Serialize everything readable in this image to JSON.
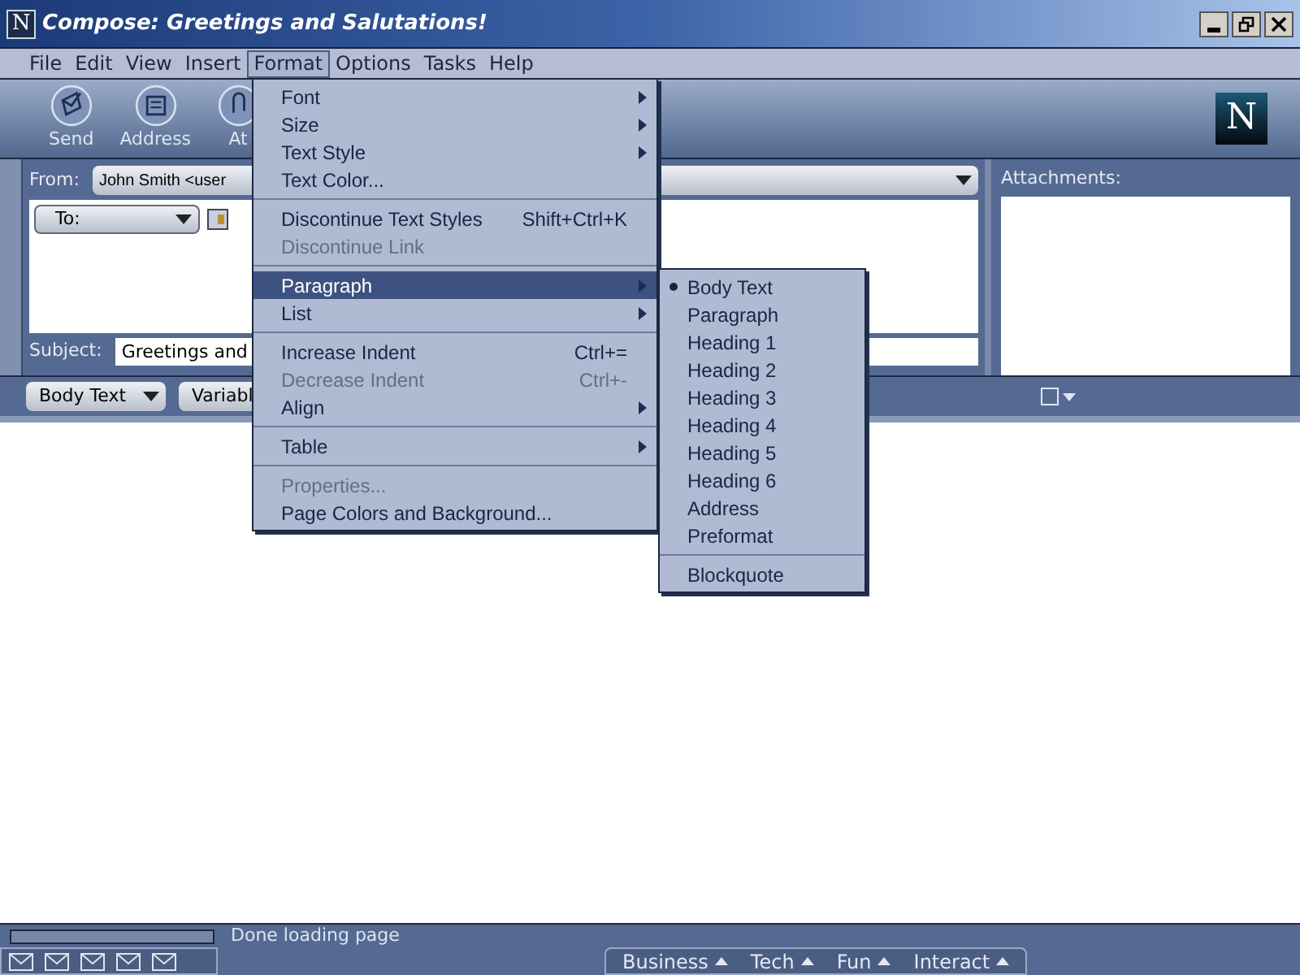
{
  "window": {
    "title": "Compose: Greetings and Salutations!",
    "logo_letter": "N"
  },
  "brand_letter": "N",
  "menubar": [
    {
      "label": "File",
      "selected": false
    },
    {
      "label": "Edit",
      "selected": false
    },
    {
      "label": "View",
      "selected": false
    },
    {
      "label": "Insert",
      "selected": false
    },
    {
      "label": "Format",
      "selected": true
    },
    {
      "label": "Options",
      "selected": false
    },
    {
      "label": "Tasks",
      "selected": false
    },
    {
      "label": "Help",
      "selected": false
    }
  ],
  "toolbar": [
    {
      "label": "Send",
      "kind": "send"
    },
    {
      "label": "Address",
      "kind": "address"
    },
    {
      "label": "At",
      "kind": "attach"
    }
  ],
  "header": {
    "from_label": "From:",
    "from_value": "John Smith <user",
    "to_label": "To:",
    "subject_label": "Subject:",
    "subject_value": "Greetings and",
    "attachments_label": "Attachments:"
  },
  "format_toolbar": {
    "style": "Body Text",
    "font": "Variabl"
  },
  "format_menu": [
    [
      {
        "label": "Font",
        "submenu": true,
        "disabled": false,
        "selected": false
      },
      {
        "label": "Size",
        "submenu": true,
        "disabled": false,
        "selected": false
      },
      {
        "label": "Text Style",
        "submenu": true,
        "disabled": false,
        "selected": false
      },
      {
        "label": "Text Color...",
        "submenu": false,
        "disabled": false,
        "selected": false
      }
    ],
    [
      {
        "label": "Discontinue Text Styles",
        "shortcut": "Shift+Ctrl+K",
        "submenu": false,
        "disabled": false,
        "selected": false
      },
      {
        "label": "Discontinue Link",
        "submenu": false,
        "disabled": true,
        "selected": false
      }
    ],
    [
      {
        "label": "Paragraph",
        "submenu": true,
        "disabled": false,
        "selected": true
      },
      {
        "label": "List",
        "submenu": true,
        "disabled": false,
        "selected": false
      }
    ],
    [
      {
        "label": "Increase Indent",
        "shortcut": "Ctrl+=",
        "submenu": false,
        "disabled": false,
        "selected": false
      },
      {
        "label": "Decrease Indent",
        "shortcut": "Ctrl+-",
        "submenu": false,
        "disabled": true,
        "selected": false
      },
      {
        "label": "Align",
        "submenu": true,
        "disabled": false,
        "selected": false
      }
    ],
    [
      {
        "label": "Table",
        "submenu": true,
        "disabled": false,
        "selected": false
      }
    ],
    [
      {
        "label": "Properties...",
        "submenu": false,
        "disabled": true,
        "selected": false
      },
      {
        "label": "Page Colors and Background...",
        "submenu": false,
        "disabled": false,
        "selected": false
      }
    ]
  ],
  "paragraph_menu": [
    [
      {
        "label": "Body Text",
        "checked": true
      },
      {
        "label": "Paragraph",
        "checked": false
      },
      {
        "label": "Heading 1",
        "checked": false
      },
      {
        "label": "Heading 2",
        "checked": false
      },
      {
        "label": "Heading 3",
        "checked": false
      },
      {
        "label": "Heading 4",
        "checked": false
      },
      {
        "label": "Heading 5",
        "checked": false
      },
      {
        "label": "Heading 6",
        "checked": false
      },
      {
        "label": "Address",
        "checked": false
      },
      {
        "label": "Preformat",
        "checked": false
      }
    ],
    [
      {
        "label": "Blockquote",
        "checked": false
      }
    ]
  ],
  "status_bar": {
    "progress": {
      "level": 0
    },
    "text": "Done loading page",
    "tabs": [
      "Business",
      "Tech",
      "Fun",
      "Interact"
    ]
  }
}
